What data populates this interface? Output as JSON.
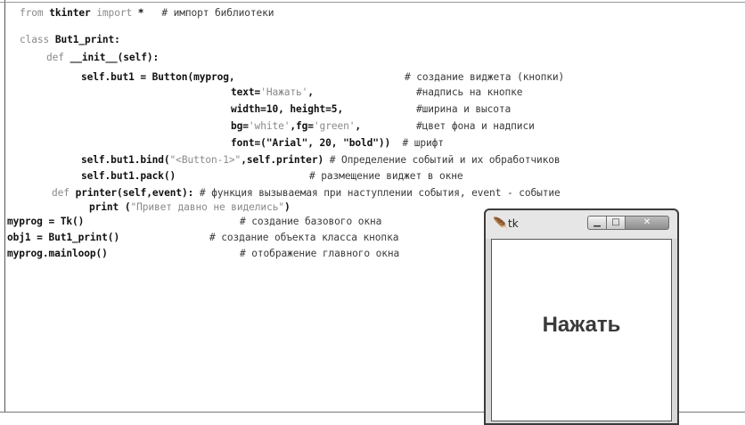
{
  "code": {
    "l1_kw1": "from",
    "l1_mod": "tkinter",
    "l1_kw2": "import",
    "l1_star": "*",
    "l1_comment": "# импорт библиотеки",
    "l2_kw": "class",
    "l2_name": "But1_print:",
    "l3_kw": "def",
    "l3_rest": "__init__(self):",
    "l4_code": "self.but1 = Button(myprog,",
    "l4_comment": "# создание виджета (кнопки)",
    "l5_a": "text=",
    "l5_str": "'Нажать'",
    "l5_b": ",",
    "l5_comment": "#надпись на кнопке",
    "l6_code": "width=10, height=5,",
    "l6_comment": "#ширина и высота",
    "l7_a": "bg=",
    "l7_s1": "'white'",
    "l7_b": ",fg=",
    "l7_s2": "'green'",
    "l7_c": ",",
    "l7_comment": "#цвет фона и надписи",
    "l8_a": "font=(\"Arial\", 20, \"bold\"))",
    "l8_comment": "# шрифт",
    "l9_a": "self.but1.bind(",
    "l9_str": "\"<Button-1>\"",
    "l9_b": ",self.printer)",
    "l9_comment": "# Определение событий и их обработчиков",
    "l10_code": "self.but1.pack()",
    "l10_comment": "# размещение виджет в окне",
    "l11_kw": "def",
    "l11_code": "printer(self,event):",
    "l11_comment": "# функция вызываемая при наступлении события, event - событие",
    "l12_a": "print (",
    "l12_str": "\"Привет давно не виделись\"",
    "l12_b": ")",
    "l13_code": "myprog = Tk()",
    "l13_comment": "# создание базового окна",
    "l14_code": "obj1 = But1_print()",
    "l14_comment": "# создание объекта класса кнопка",
    "l15_code": "myprog.mainloop()",
    "l15_comment": "# отображение главного окна"
  },
  "tk_window": {
    "title": "tk",
    "button_text": "Нажать"
  },
  "icons": {
    "feather": "tk-feather-icon",
    "minimize": "minimize-icon",
    "maximize": "maximize-icon",
    "close": "close-icon"
  }
}
